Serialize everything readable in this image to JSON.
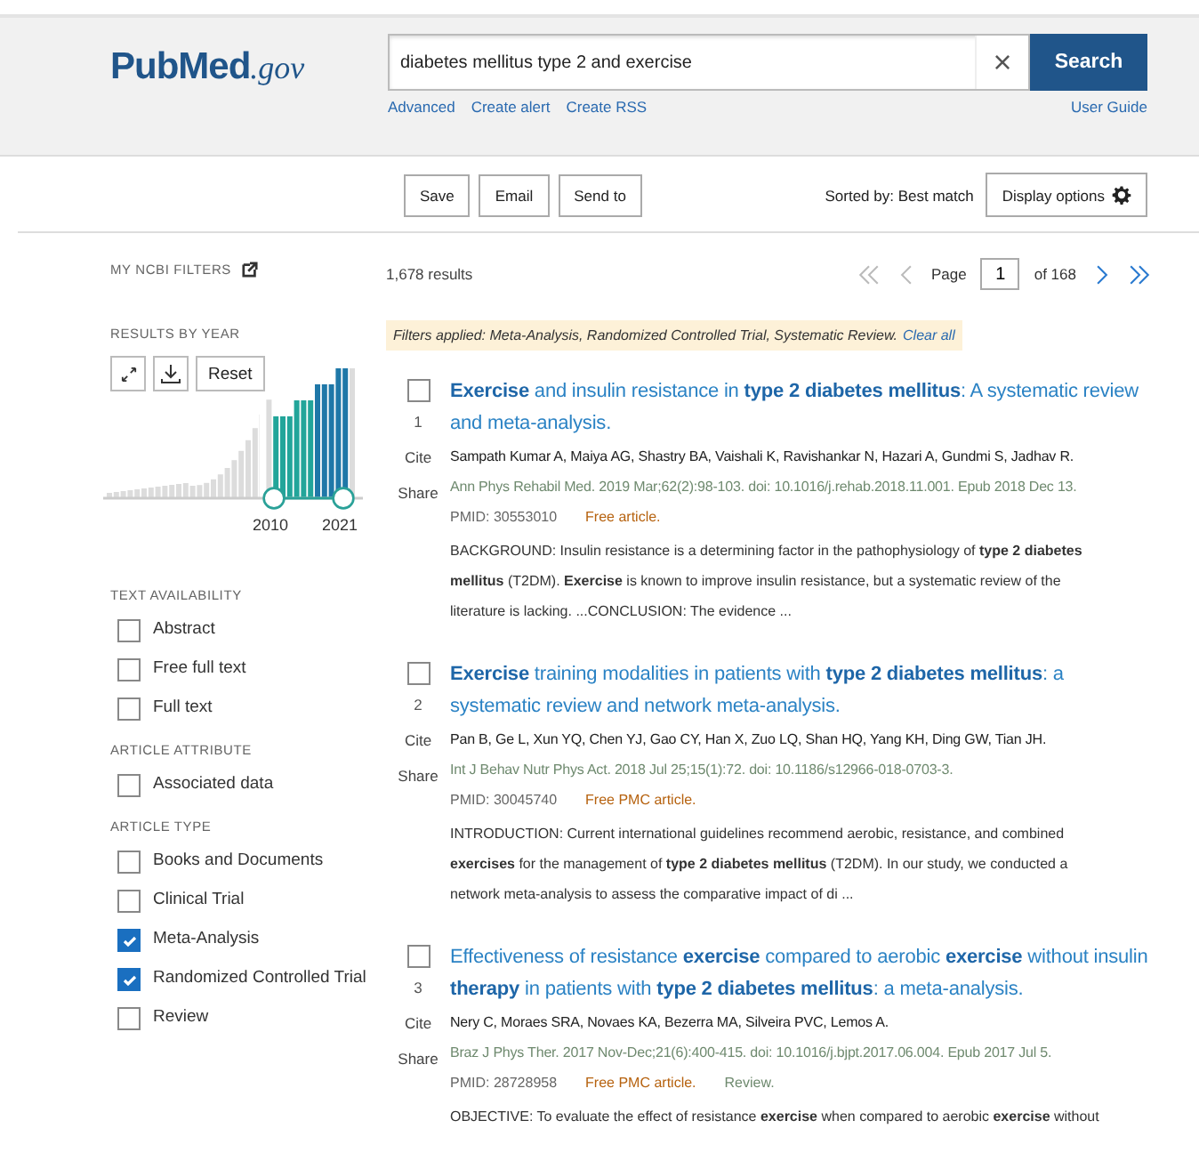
{
  "header": {
    "logo": {
      "main": "PubMed",
      "suffix": ".gov"
    },
    "search": {
      "value": "diabetes mellitus type 2 and exercise",
      "clear": "×",
      "button": "Search"
    },
    "links": [
      "Advanced",
      "Create alert",
      "Create RSS"
    ],
    "user_guide": "User Guide"
  },
  "actions": {
    "buttons": [
      "Save",
      "Email",
      "Send to"
    ],
    "sorted_by": "Sorted by: Best match",
    "display_options": "Display options"
  },
  "sidebar": {
    "my_filters": "MY NCBI FILTERS",
    "results_by_year": {
      "title": "RESULTS BY YEAR",
      "reset": "Reset",
      "start_label": "2010",
      "end_label": "2021"
    },
    "groups": [
      {
        "title": "TEXT AVAILABILITY",
        "items": [
          {
            "label": "Abstract",
            "checked": false
          },
          {
            "label": "Free full text",
            "checked": false
          },
          {
            "label": "Full text",
            "checked": false
          }
        ]
      },
      {
        "title": "ARTICLE ATTRIBUTE",
        "items": [
          {
            "label": "Associated data",
            "checked": false
          }
        ]
      },
      {
        "title": "ARTICLE TYPE",
        "items": [
          {
            "label": "Books and Documents",
            "checked": false
          },
          {
            "label": "Clinical Trial",
            "checked": false
          },
          {
            "label": "Meta-Analysis",
            "checked": true
          },
          {
            "label": "Randomized Controlled Trial",
            "checked": true
          },
          {
            "label": "Review",
            "checked": false
          }
        ]
      }
    ]
  },
  "results_count": "1,678 results",
  "pagination": {
    "page_label": "Page",
    "page": "1",
    "of": "of 168"
  },
  "filters_applied": {
    "text": "Filters applied: Meta-Analysis, Randomized Controlled Trial, Systematic Review.",
    "clear": "Clear all"
  },
  "results": [
    {
      "checked": false,
      "number": "1",
      "cite": "Cite",
      "share": "Share",
      "title": "**Exercise** and insulin resistance in **type 2 diabetes mellitus**: A systematic review and meta-analysis.",
      "authors": "Sampath Kumar A, Maiya AG, Shastry BA, Vaishali K, Ravishankar N, Hazari A, Gundmi S, Jadhav R.",
      "citation": "Ann Phys Rehabil Med. 2019 Mar;62(2):98-103. doi: 10.1016/j.rehab.2018.11.001. Epub 2018 Dec 13.",
      "pmid": "PMID: 30553010",
      "tags": [
        {
          "kind": "free",
          "text": "Free article."
        }
      ],
      "snippet": "BACKGROUND: Insulin resistance is a determining factor in the pathophysiology of **type 2 diabetes mellitus** (T2DM). **Exercise** is known to improve insulin resistance, but a systematic review of the literature is lacking. ...CONCLUSION: The evidence ..."
    },
    {
      "checked": false,
      "number": "2",
      "cite": "Cite",
      "share": "Share",
      "title": "**Exercise** training modalities in patients with **type 2 diabetes mellitus**: a systematic review and network meta-analysis.",
      "authors": "Pan B, Ge L, Xun YQ, Chen YJ, Gao CY, Han X, Zuo LQ, Shan HQ, Yang KH, Ding GW, Tian JH.",
      "citation": "Int J Behav Nutr Phys Act. 2018 Jul 25;15(1):72. doi: 10.1186/s12966-018-0703-3.",
      "pmid": "PMID: 30045740",
      "tags": [
        {
          "kind": "free",
          "text": "Free PMC article."
        }
      ],
      "snippet": "INTRODUCTION: Current international guidelines recommend aerobic, resistance, and combined **exercises** for the management of **type 2 diabetes mellitus** (T2DM). In our study, we conducted a network meta-analysis to assess the comparative impact of di ..."
    },
    {
      "checked": false,
      "number": "3",
      "cite": "Cite",
      "share": "Share",
      "title": "Effectiveness of resistance **exercise** compared to aerobic **exercise** without insulin **therapy** in patients with **type 2 diabetes mellitus**: a meta-analysis.",
      "authors": "Nery C, Moraes SRA, Novaes KA, Bezerra MA, Silveira PVC, Lemos A.",
      "citation": "Braz J Phys Ther. 2017 Nov-Dec;21(6):400-415. doi: 10.1016/j.bjpt.2017.06.004. Epub 2017 Jul 5.",
      "pmid": "PMID: 28728958",
      "tags": [
        {
          "kind": "free",
          "text": "Free PMC article."
        },
        {
          "kind": "type",
          "text": "Review."
        }
      ],
      "snippet": "OBJECTIVE: To evaluate the effect of resistance **exercise** when compared to aerobic **exercise** without"
    }
  ]
}
